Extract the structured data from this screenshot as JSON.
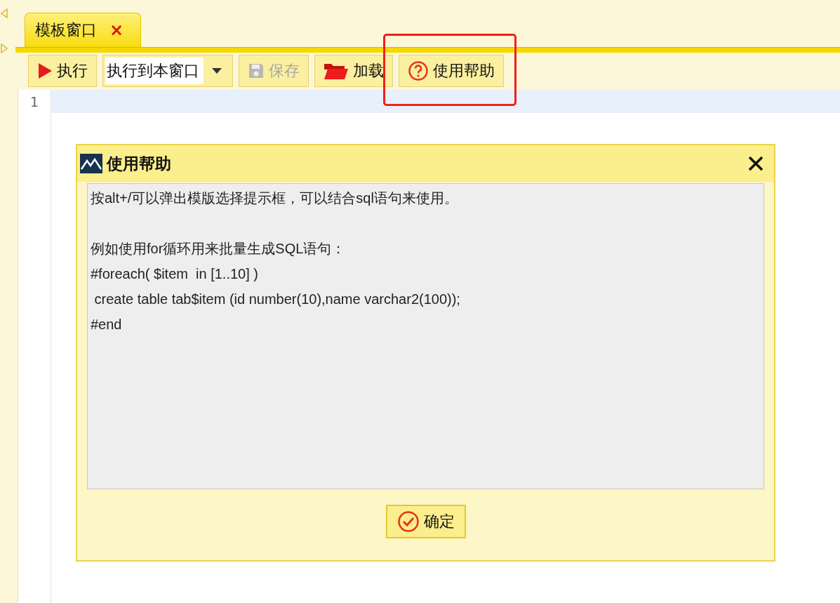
{
  "tabs": [
    {
      "label": "模板窗口",
      "selected": true,
      "close_glyph": "×"
    }
  ],
  "toolbar": [
    {
      "kind": "play",
      "label": "执行",
      "disabled": false,
      "highlighted": false
    },
    {
      "kind": "dropdown",
      "value": "执行到本窗口"
    },
    {
      "kind": "save",
      "label": "保存",
      "disabled": true,
      "highlighted": false
    },
    {
      "kind": "folder",
      "label": "加载",
      "disabled": false,
      "highlighted": false
    },
    {
      "kind": "help",
      "label": "使用帮助",
      "disabled": false,
      "highlighted": true
    }
  ],
  "editor": {
    "lines": [
      {
        "number": "1",
        "current": true
      }
    ]
  },
  "dialog": {
    "title": "使用帮助",
    "paragraphs": [
      {
        "lines": [
          "按alt+/可以弹出模版选择提示框，可以结合sql语句来使用。"
        ]
      },
      {
        "lines": [
          "例如使用for循环用来批量生成SQL语句：",
          "#foreach( $item  in [1..10] )",
          " create table tab$item (id number(10),name varchar2(100));",
          "#end"
        ]
      }
    ],
    "ok_button": "确定"
  }
}
